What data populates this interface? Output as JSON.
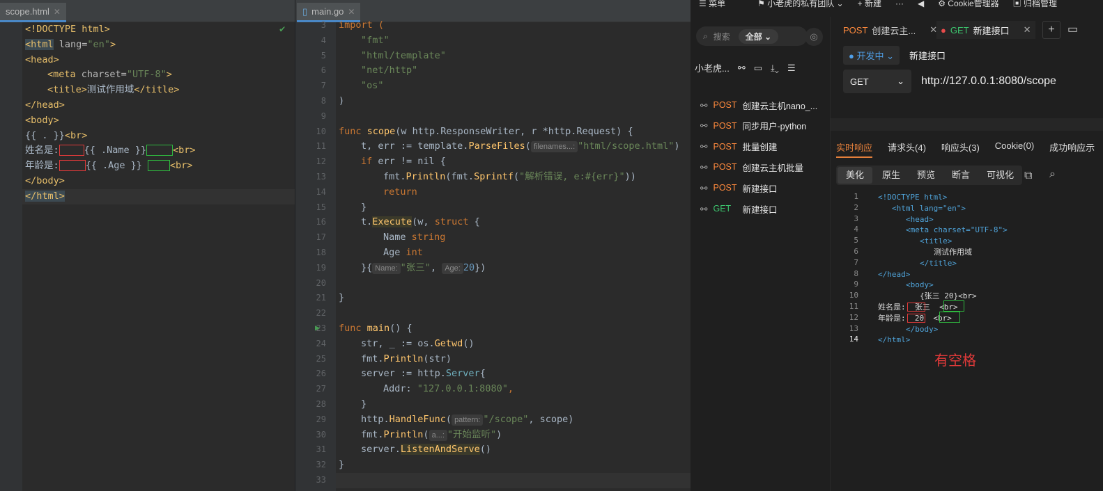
{
  "left": {
    "tab_label": "scope.html",
    "lines": [
      {
        "t": "doctype",
        "text": "<!DOCTYPE html>"
      },
      {
        "t": "html",
        "open": "<html",
        " attr": " lang=",
        "val": "\"en\"",
        "close": ">"
      },
      {
        "t": "tag",
        "text": "<head>"
      },
      {
        "t": "meta",
        "text": "<meta charset=\"UTF-8\">"
      },
      {
        "t": "title",
        "a": "<title>",
        "b": "测试作用域",
        "c": "</title>"
      },
      {
        "t": "tag",
        "text": "</head>"
      },
      {
        "t": "tag",
        "text": "<body>"
      },
      {
        "t": "plain",
        "a": "{{ . }}",
        "b": "<br>"
      },
      {
        "t": "name",
        "a": "姓名是:",
        "b": "{{ .Name }}",
        "c": "<br>"
      },
      {
        "t": "age",
        "a": "年龄是:",
        "b": "{{ .Age }}",
        "c": "<br>"
      },
      {
        "t": "tag",
        "text": "</body>"
      },
      {
        "t": "tag",
        "text": "</html>"
      }
    ]
  },
  "mid": {
    "tab_label": "main.go",
    "line_numbers": [
      "3",
      "4",
      "5",
      "6",
      "7",
      "8",
      "9",
      "10",
      "11",
      "12",
      "13",
      "14",
      "15",
      "16",
      "17",
      "18",
      "19",
      "20",
      "21",
      "22",
      "23",
      "24",
      "25",
      "26",
      "27",
      "28",
      "29",
      "30",
      "31",
      "32",
      "33"
    ],
    "code": {
      "l3": "import (",
      "l4": "\"fmt\"",
      "l5": "\"html/template\"",
      "l6": "\"net/http\"",
      "l7": "\"os\"",
      "l8": ")",
      "l10a": "func ",
      "l10b": "scope",
      "l10c": "(w http.ResponseWriter, r *http.Request) {",
      "l11a": "t, err := template.",
      "l11b": "ParseFiles",
      "l11c": "(",
      "l11hint": "filenames...:",
      "l11d": "\"html/scope.html\"",
      "l11e": ")",
      "l12a": "if ",
      "l12b": "err != nil {",
      "l13a": "fmt.",
      "l13b": "Println",
      "l13c": "(fmt.",
      "l13d": "Sprintf",
      "l13e": "(",
      "l13f": "\"解析错误, e:#{err}\"",
      "l13g": "))",
      "l14": "return",
      "l15": "}",
      "l16a": "t.",
      "l16b": "Execute",
      "l16c": "(w, ",
      "l16d": "struct",
      "l16e": " {",
      "l17a": "Name ",
      "l17b": "string",
      "l18a": "Age ",
      "l18b": "int",
      "l19a": "}{",
      "l19h1": "Name:",
      "l19b": "\"张三\"",
      "l19c": ", ",
      "l19h2": "Age:",
      "l19d": "20",
      "l19e": "})",
      "l21": "}",
      "l23a": "func ",
      "l23b": "main",
      "l23c": "() {",
      "l24a": "str, _ := os.",
      "l24b": "Getwd",
      "l24c": "()",
      "l25a": "fmt.",
      "l25b": "Println",
      "l25c": "(str)",
      "l26a": "server := http.",
      "l26b": "Server",
      "l26c": "{",
      "l27a": "Addr: ",
      "l27b": "\"127.0.0.1:8080\"",
      "l27c": ",",
      "l28": "}",
      "l29a": "http.",
      "l29b": "HandleFunc",
      "l29c": "(",
      "l29hint": "pattern:",
      "l29d": "\"/scope\"",
      "l29e": ", scope)",
      "l30a": "fmt.",
      "l30b": "Println",
      "l30c": "(",
      "l30hint": "a...:",
      "l30d": "\"开始监听\"",
      "l30e": ")",
      "l31a": "server.",
      "l31b": "ListenAndServe",
      "l31c": "()",
      "l32": "}"
    }
  },
  "right": {
    "top": {
      "menu": "菜单",
      "team": "小老虎的私有团队",
      "new": "新建",
      "cookie": "Cookie管理器",
      "archive": "归档管理"
    },
    "search": {
      "placeholder": "搜索",
      "all_label": "全部"
    },
    "project_name": "小老虎...",
    "apis": [
      {
        "method": "POST",
        "name": "创建云主机nano_..."
      },
      {
        "method": "POST",
        "name": "同步用户-python"
      },
      {
        "method": "POST",
        "name": "批量创建"
      },
      {
        "method": "POST",
        "name": "创建云主机批量"
      },
      {
        "method": "POST",
        "name": "新建接口"
      },
      {
        "method": "GET",
        "name": "新建接口"
      }
    ],
    "tabs": [
      {
        "method": "POST",
        "name": "创建云主...",
        "close": "✕"
      },
      {
        "method": "GET",
        "name": "新建接口",
        "close": "✕"
      }
    ],
    "env": "开发中",
    "request_name": "新建接口",
    "method": "GET",
    "url": "http://127.0.0.1:8080/scope",
    "resp_tabs": [
      "实时响应",
      "请求头(4)",
      "响应头(3)",
      "Cookie(0)",
      "成功响应示"
    ],
    "view_tabs": [
      "美化",
      "原生",
      "预览",
      "断言",
      "可视化"
    ],
    "resp_lines": [
      {
        "n": "1",
        "text": "<!DOCTYPE html>"
      },
      {
        "n": "2",
        "text": "<html lang=\"en\">"
      },
      {
        "n": "3",
        "text": "<head>"
      },
      {
        "n": "4",
        "text": "<meta charset=\"UTF-8\">"
      },
      {
        "n": "5",
        "text": "<title>"
      },
      {
        "n": "6",
        "text": "测试作用域"
      },
      {
        "n": "7",
        "text": "</title>"
      },
      {
        "n": "8",
        "text": "</head>"
      },
      {
        "n": "9",
        "text": "<body>"
      },
      {
        "n": "10",
        "text": "{张三 20}<br>"
      },
      {
        "n": "11",
        "text": "姓名是:  张三  <br>"
      },
      {
        "n": "12",
        "text": "年龄是:  20  <br>"
      },
      {
        "n": "13",
        "text": "</body>"
      },
      {
        "n": "14",
        "text": "</html>"
      }
    ],
    "note": "有空格"
  }
}
